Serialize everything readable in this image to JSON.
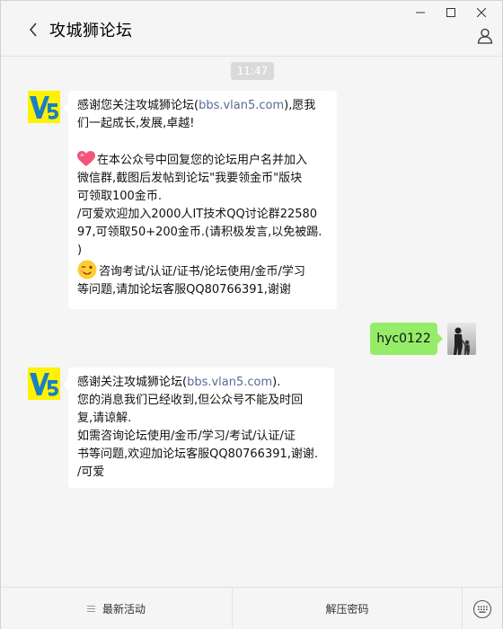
{
  "header": {
    "title": "攻城狮论坛"
  },
  "chat": {
    "time": "11:47",
    "messages": [
      {
        "from": "bot",
        "lines": {
          "l1": "感谢您关注攻城狮论坛(",
          "l1_link": "bbs.vlan5.com",
          "l1_end": "),愿我",
          "l2": "们一起成长,发展,卓越!",
          "l3": "在本公众号中回复您的论坛用户名并加入",
          "l4": "微信群,截图后发帖到论坛\"我要领金币\"版块",
          "l5": "可领取100金币.",
          "l6": "/可爱欢迎加入2000人IT技术QQ讨论群22580",
          "l7": "97,可领取50+200金币.(请积极发言,以免被踢.",
          "l8": ")",
          "l9": "咨询考试/认证/证书/论坛使用/金币/学习",
          "l10": "等问题,请加论坛客服QQ80766391,谢谢"
        }
      },
      {
        "from": "me",
        "text": "hyc0122"
      },
      {
        "from": "bot",
        "lines": {
          "l1": "感谢关注攻城狮论坛(",
          "l1_link": "bbs.vlan5.com",
          "l1_end": ").",
          "l2": "您的消息我们已经收到,但公众号不能及时回",
          "l3": "复,请谅解.",
          "l4": "如需咨询论坛使用/金币/学习/考试/认证/证",
          "l5": "书等问题,欢迎加论坛客服QQ80766391,谢谢.",
          "l6": "/可爱"
        }
      }
    ]
  },
  "bot_avatar": {
    "logo_text": "V5"
  },
  "menu": {
    "item1": "最新活动",
    "item2": "解压密码"
  },
  "icons": {
    "back": "chevron-left-icon",
    "profile": "person-icon",
    "minimize": "minimize-icon",
    "maximize": "maximize-icon",
    "close": "close-icon",
    "keyboard": "keyboard-icon"
  },
  "colors": {
    "my_bubble": "#95ec69",
    "link": "#576b95",
    "background": "#f5f5f5"
  }
}
